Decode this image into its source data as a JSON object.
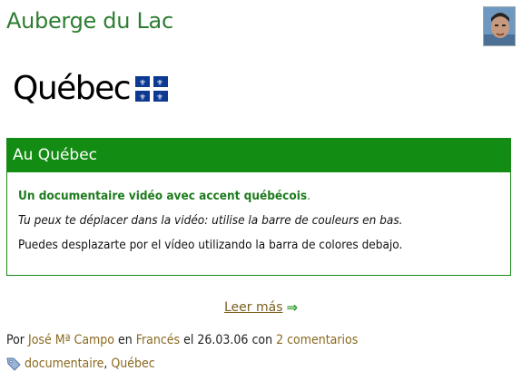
{
  "header": {
    "site_title": "Auberge du Lac",
    "avatar_alt": "author photo"
  },
  "logo": {
    "word": "Québec"
  },
  "box": {
    "title": "Au Québec",
    "line1_text": "Un documentaire vidéo avec accent québécois",
    "line1_end": ".",
    "line2": "Tu peux te déplacer dans la vidéo: utilise la barre de couleurs en bas.",
    "line3": "Puedes desplazarte por el vídeo utilizando la barra de colores debajo."
  },
  "read_more": {
    "label": "Leer más",
    "arrow": "⇒"
  },
  "meta": {
    "by": "Por",
    "author": "José Mª Campo",
    "in": "en",
    "category": "Francés",
    "date_prefix": "el",
    "date": "26.03.06",
    "with": "con",
    "comments": "2 comentarios"
  },
  "tags": {
    "icon": "tag-icon",
    "items": [
      "documentaire",
      "Québec"
    ],
    "separator": ","
  },
  "colors": {
    "accent_green": "#128c12",
    "title_green": "#2e7d32",
    "link_brown": "#8a6a20"
  }
}
